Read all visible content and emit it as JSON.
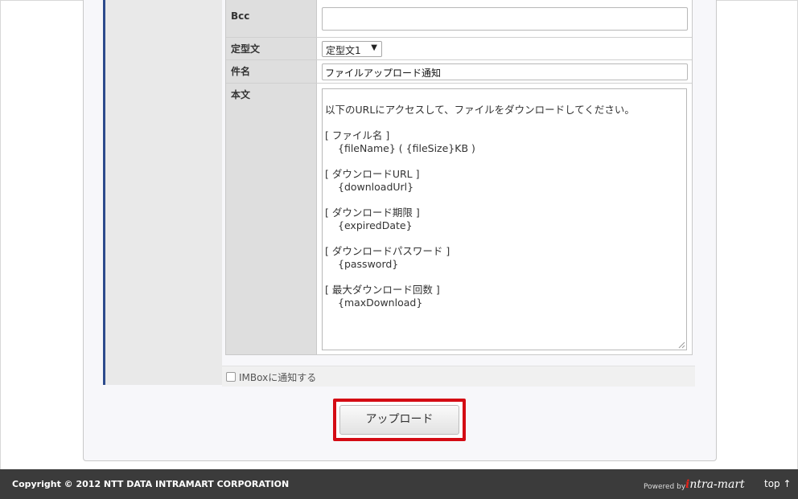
{
  "form": {
    "bcc": {
      "label": "Bcc",
      "value": ""
    },
    "template": {
      "label": "定型文",
      "selected": "定型文1"
    },
    "subject": {
      "label": "件名",
      "value": "ファイルアップロード通知"
    },
    "body": {
      "label": "本文",
      "lines": [
        "以下のURLにアクセスして、ファイルをダウンロードしてください。",
        "",
        "[ ファイル名 ]",
        "{fileName} ( {fileSize}KB )",
        "",
        "[ ダウンロードURL ]",
        "{downloadUrl}",
        "",
        "[ ダウンロード期限 ]",
        "{expiredDate}",
        "",
        "[ ダウンロードパスワード ]",
        "{password}",
        "",
        "[ 最大ダウンロード回数 ]",
        "{maxDownload}"
      ]
    },
    "imbox_notify": {
      "label": "IMBoxに通知する",
      "checked": false
    }
  },
  "upload_button": {
    "label": "アップロード",
    "highlight_color": "#d40b14"
  },
  "footer": {
    "copyright": "Copyright © 2012 NTT DATA INTRAMART CORPORATION",
    "powered_by": "Powered by",
    "logo": "intra-mart",
    "top_link": "top ↑"
  },
  "colors": {
    "accent_bar": "#2d4b8d",
    "footer_bg": "#3b3b3b"
  },
  "icons": {
    "select_arrow": "chevron-down-icon",
    "resize_grip": "resize-grip-icon"
  }
}
